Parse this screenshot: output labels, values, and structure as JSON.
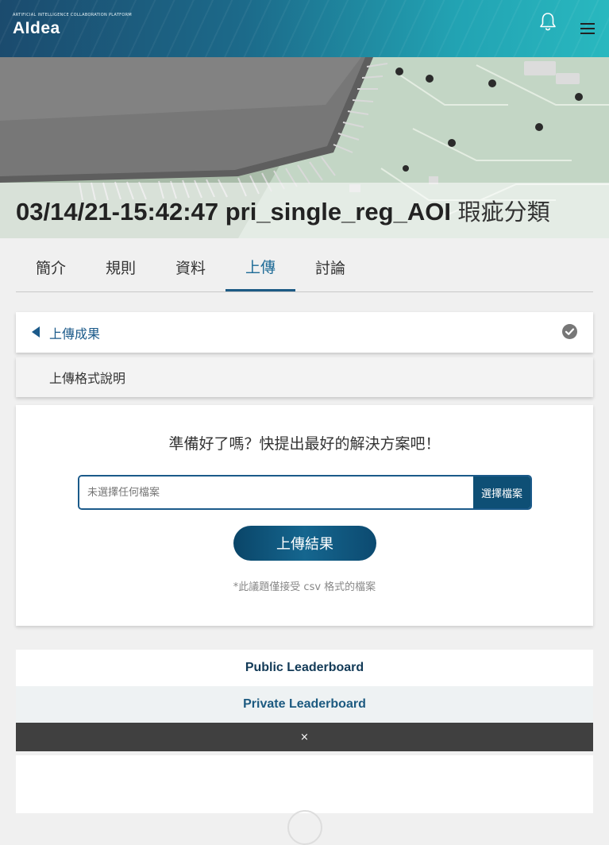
{
  "header": {
    "logo_tagline": "ARTIFICIAL INTELLIGENCE COLLABORATION PLATFORM",
    "logo_name": "AIdea",
    "notification_icon": "bell-icon",
    "menu_icon": "hamburger-menu-icon"
  },
  "hero": {
    "title_id": "03/14/21-15:42:47 pri_single_reg_AOI",
    "title_suffix": "瑕疵分類"
  },
  "tabs": [
    {
      "label": "簡介",
      "active": false
    },
    {
      "label": "規則",
      "active": false
    },
    {
      "label": "資料",
      "active": false
    },
    {
      "label": "上傳",
      "active": true
    },
    {
      "label": "討論",
      "active": false
    }
  ],
  "accordion": {
    "upload_results_label": "上傳成果",
    "upload_format_label": "上傳格式說明",
    "status_icon": "check-circle-icon"
  },
  "upload": {
    "heading": "準備好了嗎？快提出最好的解決方案吧！",
    "file_placeholder": "未選擇任何檔案",
    "choose_file_label": "選擇檔案",
    "submit_label": "上傳結果",
    "note": "*此議題僅接受 csv 格式的檔案"
  },
  "leaderboards": {
    "public_label": "Public Leaderboard",
    "private_label": "Private Leaderboard",
    "close_label": "×"
  },
  "colors": {
    "primary": "#1b5a8a",
    "button_dark": "#0e4f75",
    "tab_active": "#1d6a96",
    "close_bar": "#404040"
  }
}
